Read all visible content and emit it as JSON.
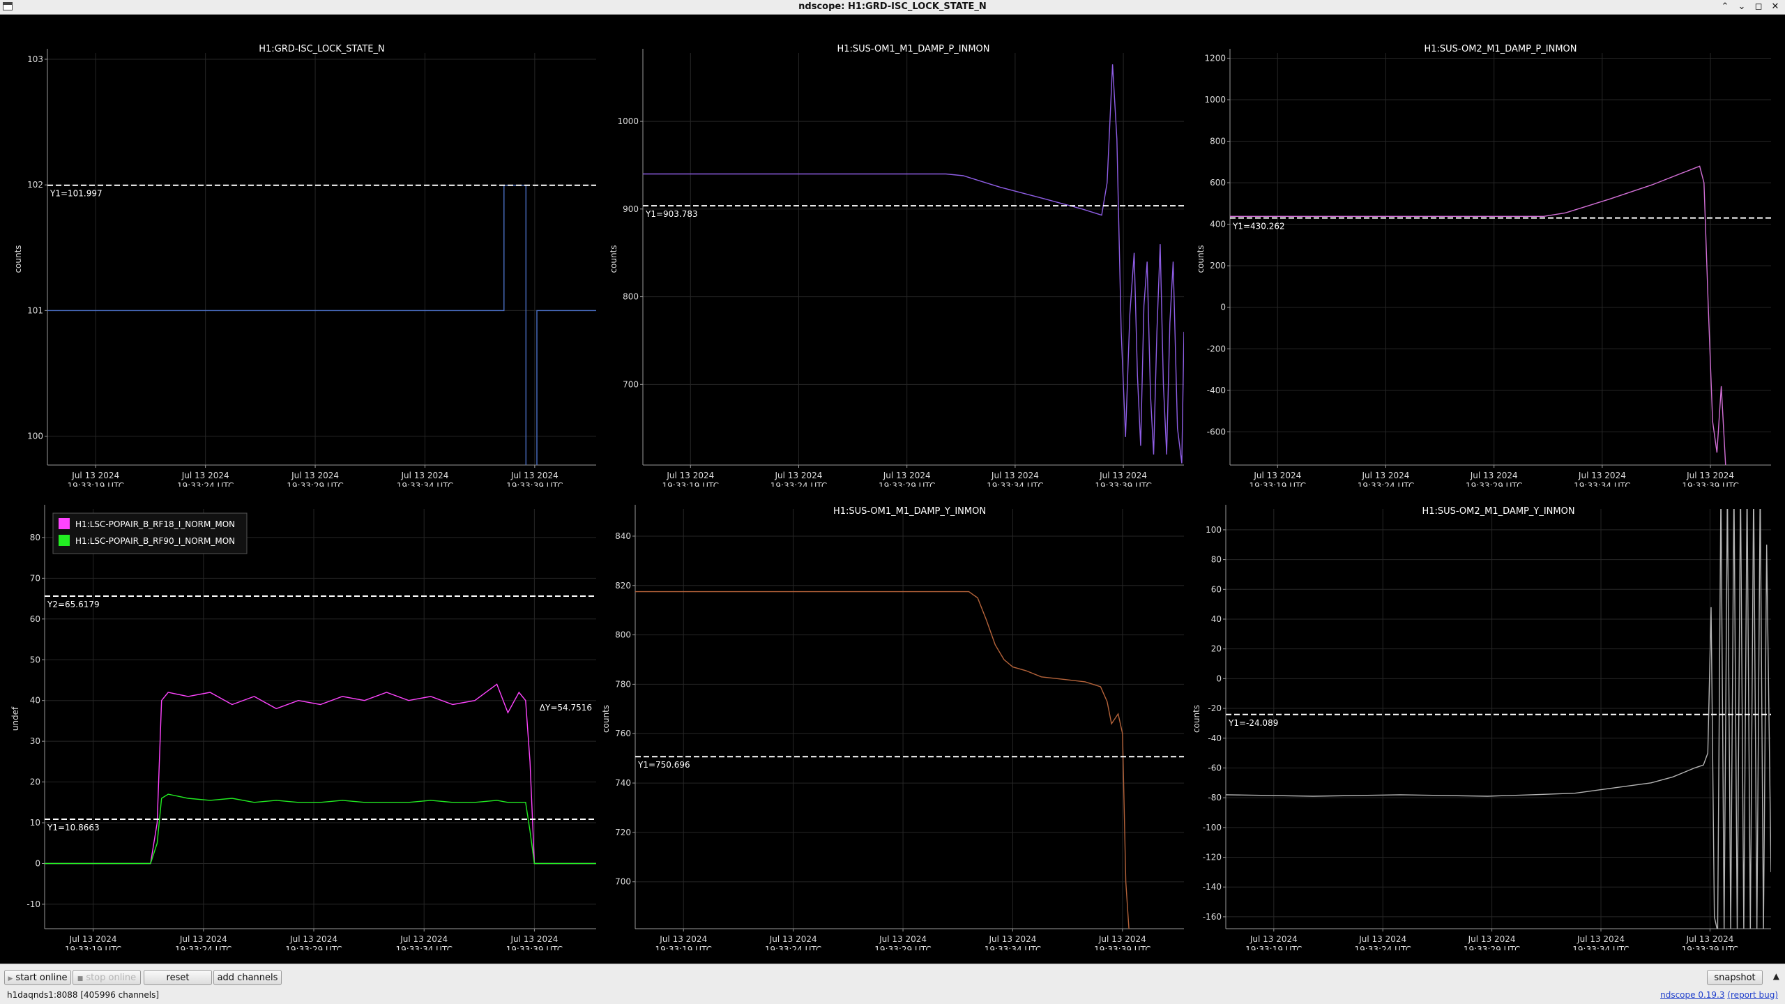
{
  "window": {
    "title": "ndscope: H1:GRD-ISC_LOCK_STATE_N",
    "controls": [
      "⌃",
      "⌄",
      "◻",
      "✕"
    ]
  },
  "time_axis": {
    "date": "Jul 13 2024",
    "times": [
      "19:33:19 UTC",
      "19:33:24 UTC",
      "19:33:29 UTC",
      "19:33:34 UTC",
      "19:33:39 UTC"
    ]
  },
  "plots": [
    {
      "title": "H1:GRD-ISC_LOCK_STATE_N",
      "ylabel": "counts",
      "yticks": [
        100,
        101,
        102,
        103
      ],
      "cursors": [
        {
          "label": "Y1=101.997",
          "value": 101.997
        }
      ],
      "chart_data": {
        "type": "line",
        "series": [
          {
            "color": "#4b6fc4",
            "x": [
              0,
              20.8,
              20.8,
              21.8,
              21.8,
              22.3,
              22.3,
              25
            ],
            "y": [
              101,
              101,
              101.997,
              101.997,
              99.5,
              99.5,
              101,
              101
            ]
          }
        ],
        "xlim": [
          0,
          25
        ],
        "ylim": [
          99.77,
          103.05
        ]
      }
    },
    {
      "title": "H1:SUS-OM1_M1_DAMP_P_INMON",
      "ylabel": "counts",
      "yticks": [
        700,
        800,
        900,
        1000
      ],
      "cursors": [
        {
          "label": "Y1=903.783",
          "value": 903.783
        }
      ],
      "chart_data": {
        "type": "line",
        "series": [
          {
            "color": "#8f5ee6",
            "x": [
              0,
              14,
              14.8,
              16.5,
              18.5,
              20.3,
              21.2,
              21.45,
              21.7,
              21.9,
              22.1,
              22.3,
              22.5,
              22.7,
              22.85,
              23.0,
              23.15,
              23.3,
              23.45,
              23.6,
              23.75,
              23.9,
              24.05,
              24.2,
              24.35,
              24.5,
              24.7,
              24.9,
              25
            ],
            "y": [
              940,
              940,
              938,
              925,
              912,
              900,
              893,
              930,
              1065,
              980,
              760,
              640,
              780,
              850,
              710,
              630,
              790,
              840,
              690,
              620,
              760,
              860,
              700,
              620,
              770,
              840,
              650,
              610,
              760
            ]
          }
        ],
        "xlim": [
          0,
          25
        ],
        "ylim": [
          608,
          1078
        ]
      }
    },
    {
      "title": "H1:SUS-OM2_M1_DAMP_P_INMON",
      "ylabel": "counts",
      "yticks": [
        -600,
        -400,
        -200,
        0,
        200,
        400,
        600,
        800,
        1000,
        1200
      ],
      "cursors": [
        {
          "label": "Y1=430.262",
          "value": 430.262
        }
      ],
      "chart_data": {
        "type": "line",
        "series": [
          {
            "color": "#d26fd6",
            "x": [
              0,
              14.5,
              15.5,
              17.5,
              19.5,
              21.7,
              21.9,
              22.1,
              22.3,
              22.5,
              22.7,
              22.9
            ],
            "y": [
              438,
              438,
              455,
              520,
              590,
              680,
              600,
              0,
              -550,
              -700,
              -380,
              -760
            ]
          }
        ],
        "xlim": [
          0,
          25
        ],
        "ylim": [
          -760,
          1225
        ]
      }
    },
    {
      "title": "",
      "ylabel": "undef",
      "yticks": [
        -10,
        0,
        10,
        20,
        30,
        40,
        50,
        60,
        70,
        80
      ],
      "cursors": [
        {
          "label": "Y2=65.6179",
          "value": 65.6179
        },
        {
          "label": "Y1=10.8663",
          "value": 10.8663
        }
      ],
      "delta_label": "ΔY=54.7516",
      "legend": [
        {
          "name": "H1:LSC-POPAIR_B_RF18_I_NORM_MON",
          "color": "#ff44ff"
        },
        {
          "name": "H1:LSC-POPAIR_B_RF90_I_NORM_MON",
          "color": "#22ee22"
        }
      ],
      "chart_data": {
        "type": "line",
        "series": [
          {
            "name": "H1:LSC-POPAIR_B_RF18_I_NORM_MON",
            "color": "#ff44ff",
            "x": [
              0,
              4.8,
              5.1,
              5.3,
              5.6,
              6.5,
              7.5,
              8.5,
              9.5,
              10.5,
              11.5,
              12.5,
              13.5,
              14.5,
              15.5,
              16.5,
              17.5,
              18.5,
              19.5,
              20.5,
              21.0,
              21.5,
              21.8,
              22.0,
              22.2,
              22.8,
              25
            ],
            "y": [
              0,
              0,
              10,
              40,
              42,
              41,
              42,
              39,
              41,
              38,
              40,
              39,
              41,
              40,
              42,
              40,
              41,
              39,
              40,
              44,
              37,
              42,
              40,
              25,
              0,
              0,
              0
            ]
          },
          {
            "name": "H1:LSC-POPAIR_B_RF90_I_NORM_MON",
            "color": "#22ee22",
            "x": [
              0,
              4.8,
              5.1,
              5.3,
              5.6,
              6.5,
              7.5,
              8.5,
              9.5,
              10.5,
              11.5,
              12.5,
              13.5,
              14.5,
              15.5,
              16.5,
              17.5,
              18.5,
              19.5,
              20.5,
              21.0,
              21.5,
              21.8,
              22.0,
              22.2,
              22.8,
              25
            ],
            "y": [
              0,
              0,
              5,
              16,
              17,
              16,
              15.5,
              16,
              15,
              15.5,
              15,
              15,
              15.5,
              15,
              15,
              15,
              15.5,
              15,
              15,
              15.5,
              15,
              15,
              15,
              8,
              0,
              0,
              0
            ]
          }
        ],
        "xlim": [
          0,
          25
        ],
        "ylim": [
          -16,
          87
        ]
      }
    },
    {
      "title": "H1:SUS-OM1_M1_DAMP_Y_INMON",
      "ylabel": "counts",
      "yticks": [
        700,
        720,
        740,
        760,
        780,
        800,
        820,
        840
      ],
      "cursors": [
        {
          "label": "Y1=750.696",
          "value": 750.696
        }
      ],
      "chart_data": {
        "type": "line",
        "series": [
          {
            "color": "#b5633a",
            "x": [
              0,
              15.2,
              15.6,
              16.0,
              16.4,
              16.8,
              17.2,
              17.8,
              18.5,
              19.5,
              20.5,
              21.2,
              21.5,
              21.7,
              22.0,
              22.2,
              22.35,
              22.5
            ],
            "y": [
              817.5,
              817.5,
              815,
              806,
              796,
              790,
              787,
              785.5,
              783,
              782,
              781,
              779,
              773,
              764,
              768,
              760,
              700,
              680
            ]
          }
        ],
        "xlim": [
          0,
          25
        ],
        "ylim": [
          681,
          851
        ]
      }
    },
    {
      "title": "H1:SUS-OM2_M1_DAMP_Y_INMON",
      "ylabel": "counts",
      "yticks": [
        -160,
        -140,
        -120,
        -100,
        -80,
        -60,
        -40,
        -20,
        0,
        20,
        40,
        60,
        80,
        100
      ],
      "cursors": [
        {
          "label": "Y1=-24.089",
          "value": -24.089
        }
      ],
      "chart_data": {
        "type": "line",
        "series": [
          {
            "color": "#b4b4b4",
            "x": [
              0,
              4,
              8,
              12,
              14,
              16,
              18,
              19.5,
              20.5,
              21.5,
              21.9,
              22.1,
              22.25,
              22.4,
              22.55,
              22.7,
              22.85,
              23.0,
              23.15,
              23.3,
              23.45,
              23.6,
              23.75,
              23.9,
              24.05,
              24.2,
              24.35,
              24.5,
              24.65,
              24.8,
              25
            ],
            "y": [
              -78,
              -79,
              -78,
              -79,
              -78,
              -77,
              -73,
              -70,
              -66,
              -60,
              -58,
              -50,
              48,
              -160,
              -170,
              130,
              -170,
              130,
              -170,
              130,
              -170,
              130,
              -170,
              130,
              -170,
              130,
              -170,
              130,
              -170,
              90,
              -130
            ]
          }
        ],
        "xlim": [
          0,
          25
        ],
        "ylim": [
          -168,
          114
        ]
      }
    }
  ],
  "toolbar": {
    "start_online": "start online",
    "stop_online": "stop online",
    "reset": "reset",
    "add_channels": "add channels",
    "snapshot": "snapshot"
  },
  "status": {
    "server": "h1daqnds1:8088  [405996 channels]",
    "version": "ndscope 0.19.3",
    "report_bug": "(report bug)"
  },
  "colors": {
    "background": "#000000",
    "grid": "#262626",
    "axis": "#9a9a9a",
    "cursor": "#ffffff"
  }
}
